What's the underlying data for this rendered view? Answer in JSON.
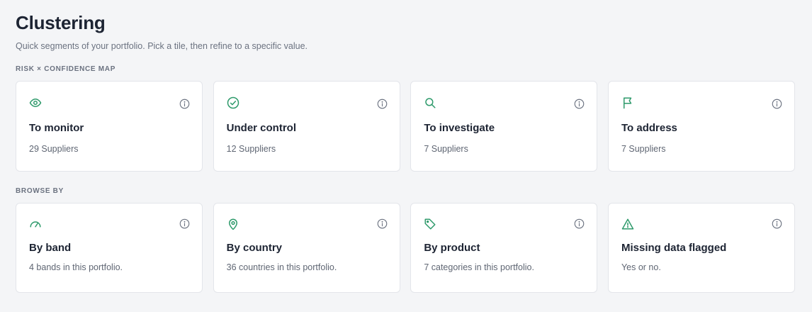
{
  "header": {
    "title": "Clustering",
    "subtitle": "Quick segments of your portfolio. Pick a tile, then refine to a specific value."
  },
  "risk_map": {
    "label": "RISK × CONFIDENCE MAP",
    "tiles": [
      {
        "icon": "eye-icon",
        "title": "To monitor",
        "subtitle": "29 Suppliers"
      },
      {
        "icon": "check-circle-icon",
        "title": "Under control",
        "subtitle": "12 Suppliers"
      },
      {
        "icon": "search-icon",
        "title": "To investigate",
        "subtitle": "7 Suppliers"
      },
      {
        "icon": "flag-icon",
        "title": "To address",
        "subtitle": "7 Suppliers"
      }
    ]
  },
  "browse_by": {
    "label": "BROWSE BY",
    "tiles": [
      {
        "icon": "gauge-icon",
        "title": "By band",
        "subtitle": "4 bands in this portfolio."
      },
      {
        "icon": "map-pin-icon",
        "title": "By country",
        "subtitle": "36 countries in this portfolio."
      },
      {
        "icon": "tag-icon",
        "title": "By product",
        "subtitle": "7 categories in this portfolio."
      },
      {
        "icon": "warning-triangle-icon",
        "title": "Missing data flagged",
        "subtitle": "Yes or no."
      }
    ]
  },
  "colors": {
    "accent": "#2e9a6b",
    "info_icon": "#6b7280"
  }
}
